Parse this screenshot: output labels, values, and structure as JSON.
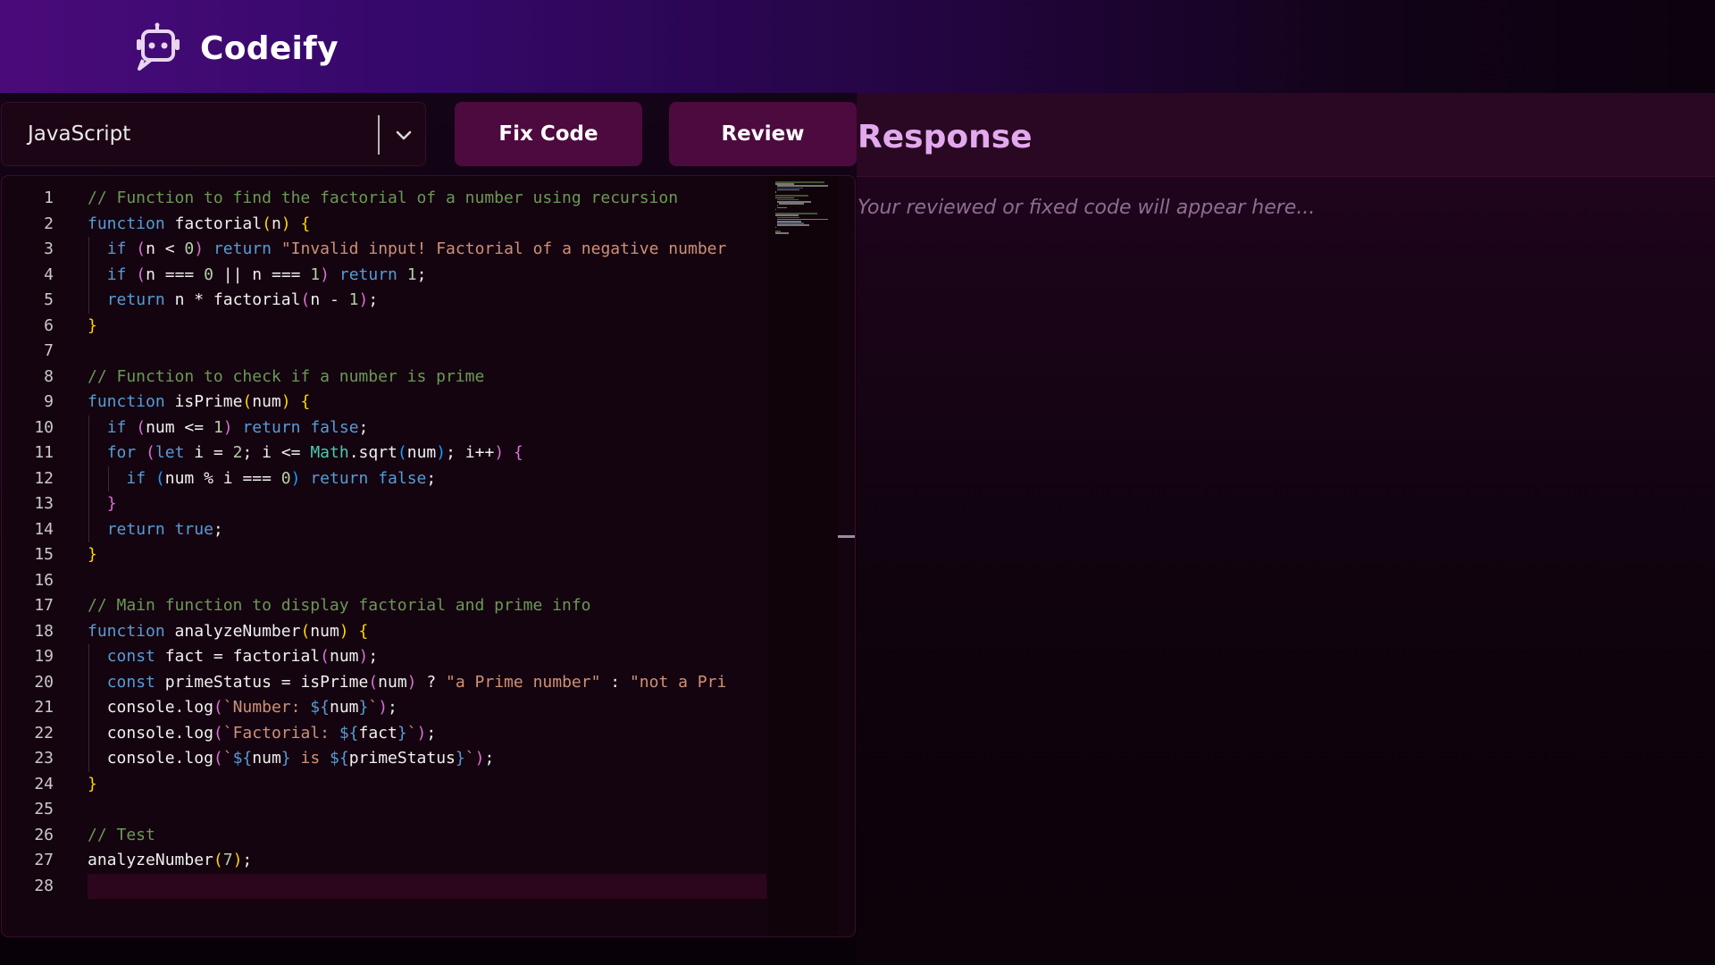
{
  "app": {
    "name": "Codeify",
    "icon": "robot-icon"
  },
  "toolbar": {
    "language": {
      "selected": "JavaScript",
      "chevron_icon": "chevron-down-icon"
    },
    "fix_button_label": "Fix Code",
    "review_button_label": "Review"
  },
  "editor": {
    "language": "javascript",
    "current_line": 28,
    "lines": [
      "// Function to find the factorial of a number using recursion",
      "function factorial(n) {",
      "  if (n < 0) return \"Invalid input! Factorial of a negative number",
      "  if (n === 0 || n === 1) return 1;",
      "  return n * factorial(n - 1);",
      "}",
      "",
      "// Function to check if a number is prime",
      "function isPrime(num) {",
      "  if (num <= 1) return false;",
      "  for (let i = 2; i <= Math.sqrt(num); i++) {",
      "    if (num % i === 0) return false;",
      "  }",
      "  return true;",
      "}",
      "",
      "// Main function to display factorial and prime info",
      "function analyzeNumber(num) {",
      "  const fact = factorial(num);",
      "  const primeStatus = isPrime(num) ? \"a Prime number\" : \"not a Pri",
      "  console.log(`Number: ${num}`);",
      "  console.log(`Factorial: ${fact}`);",
      "  console.log(`${num} is ${primeStatus}`);",
      "}",
      "",
      "// Test",
      "analyzeNumber(7);",
      ""
    ]
  },
  "response": {
    "title": "Response",
    "placeholder": "Your reviewed or fixed code will appear here..."
  },
  "colors": {
    "header_gradient_start": "#4a0b7a",
    "button_bg": "#4c0a3e",
    "response_title": "#e2a9ee",
    "placeholder_text": "#8e6d92"
  }
}
